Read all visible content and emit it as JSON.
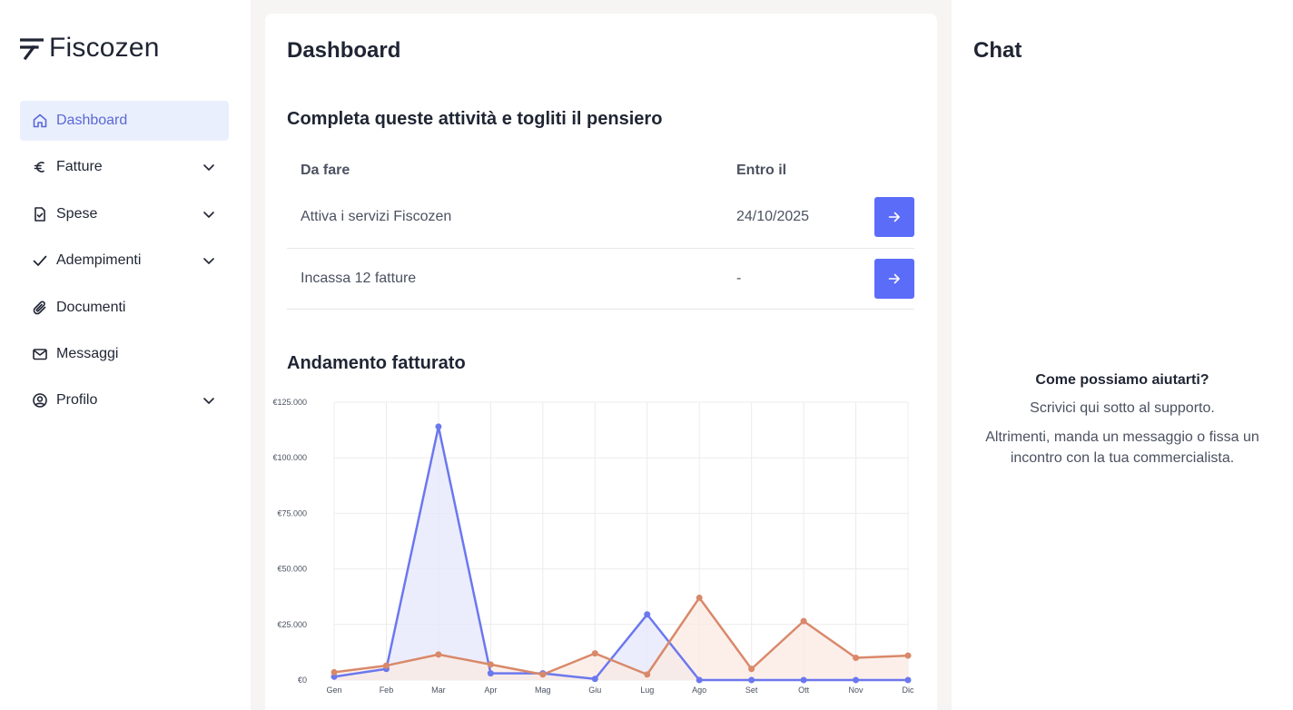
{
  "brand": {
    "name": "Fiscozen"
  },
  "sidebar": {
    "items": [
      {
        "label": "Dashboard",
        "icon": "home-icon",
        "active": true
      },
      {
        "label": "Fatture",
        "icon": "euro-icon",
        "expandable": true
      },
      {
        "label": "Spese",
        "icon": "receipt-icon",
        "expandable": true
      },
      {
        "label": "Adempimenti",
        "icon": "check-icon",
        "expandable": true
      },
      {
        "label": "Documenti",
        "icon": "paperclip-icon"
      },
      {
        "label": "Messaggi",
        "icon": "mail-icon"
      },
      {
        "label": "Profilo",
        "icon": "user-circle-icon",
        "expandable": true
      }
    ]
  },
  "main": {
    "title": "Dashboard",
    "tasks_title": "Completa queste attività e togliti il pensiero",
    "tasks_columns": [
      "Da fare",
      "Entro il"
    ],
    "tasks": [
      {
        "label": "Attiva i servizi Fiscozen",
        "due": "24/10/2025"
      },
      {
        "label": "Incassa 12 fatture",
        "due": "-"
      }
    ],
    "chart_title": "Andamento fatturato"
  },
  "chart_data": {
    "type": "area",
    "categories": [
      "Gen",
      "Feb",
      "Mar",
      "Apr",
      "Mag",
      "Giu",
      "Lug",
      "Ago",
      "Set",
      "Ott",
      "Nov",
      "Dic"
    ],
    "ylim": [
      0,
      125000
    ],
    "yticks": [
      "€0",
      "€25.000",
      "€50.000",
      "€75.000",
      "€100.000",
      "€125.000"
    ],
    "grid": true,
    "series": [
      {
        "color": "#6b78ee",
        "fill": "#e6e7fb",
        "values": [
          1500,
          5000,
          114000,
          3000,
          3000,
          500,
          29500,
          0,
          0,
          0,
          0,
          0
        ]
      },
      {
        "color": "#d9896a",
        "fill": "#fbeae3",
        "values": [
          3500,
          6500,
          11500,
          7000,
          2500,
          12000,
          2500,
          37000,
          5000,
          26500,
          10000,
          11000
        ]
      }
    ]
  },
  "chat": {
    "title": "Chat",
    "heading": "Come possiamo aiutarti?",
    "line1": "Scrivici qui sotto al supporto.",
    "line2": "Altrimenti, manda un messaggio o fissa un incontro con la tua commercialista."
  }
}
